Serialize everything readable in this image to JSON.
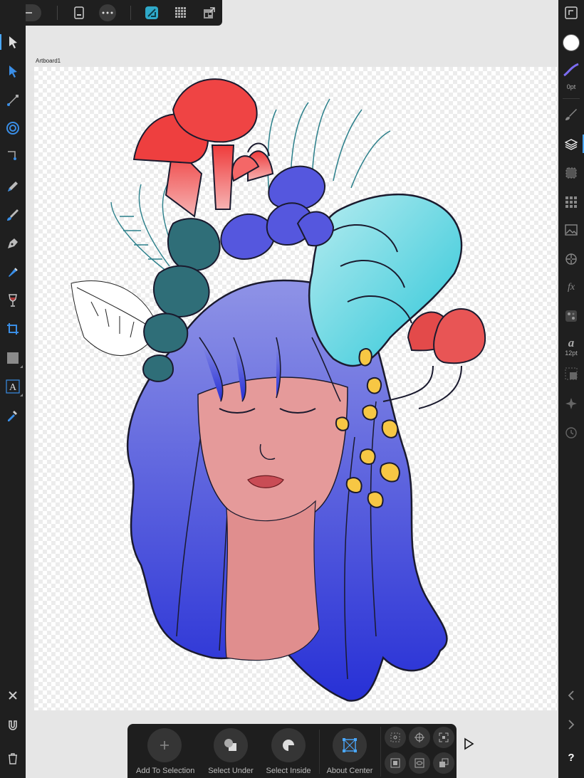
{
  "artboard": {
    "label": "Artboard1"
  },
  "toolbar_top": {
    "icons": [
      "back-arrow-icon",
      "document-icon",
      "more-icon",
      "designer-persona-icon",
      "pixel-persona-icon",
      "export-persona-icon"
    ]
  },
  "tools_left": [
    "move-tool",
    "node-tool",
    "gradient-tool",
    "radial-gradient-tool",
    "corner-tool",
    "pencil-tool",
    "vector-brush-tool",
    "pen-tool",
    "fill-tool",
    "wine-glass-tool",
    "crop-tool",
    "rectangle-tool",
    "frame-text-tool",
    "color-picker-tool"
  ],
  "left_bottom_icons": [
    "close-icon",
    "snapping-magnet-icon",
    "trash-icon"
  ],
  "right_panel": {
    "stroke_width": "0pt",
    "font_size": "12pt",
    "fill_color": "#ffffff",
    "stroke_color": "#7b6cf0"
  },
  "bottom_toolbar": {
    "add_to_selection": "Add To Selection",
    "select_under": "Select Under",
    "select_inside": "Select Inside",
    "about_center": "About Center"
  },
  "help": "?",
  "colors": {
    "ui_dark": "#1f1f1f",
    "accent": "#4aa8ff",
    "canvas_bg": "#e6e6e6"
  }
}
